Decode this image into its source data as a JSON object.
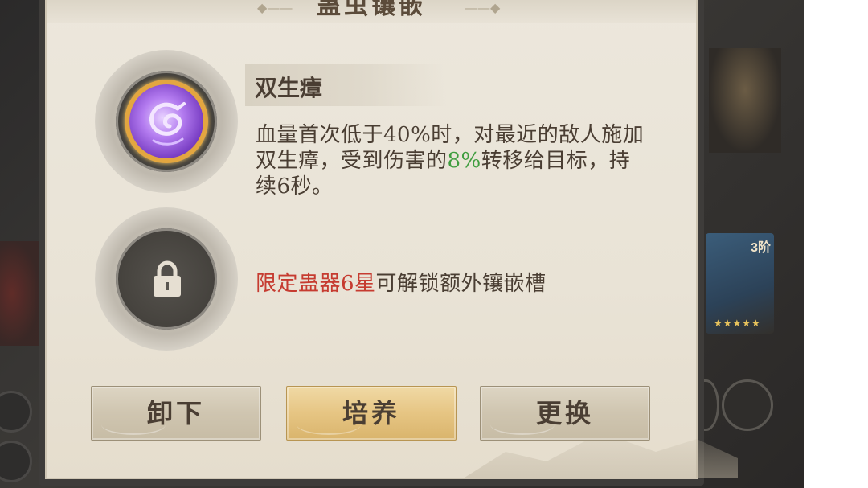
{
  "dialog": {
    "title": "蛊虫镶嵌"
  },
  "slot1": {
    "skill_name": "双生瘴",
    "desc_part1": "血量首次低于40%时，对最近的敌人施加双生瘴，受到伤害的",
    "desc_highlight": "8%",
    "desc_part2": "转移给目标，持续6秒。",
    "highlight_color": "#3f9d3f",
    "gem_icon": "purple-serpent-icon"
  },
  "slot2": {
    "lock_icon": "lock-icon",
    "unlock_condition": "限定蛊器6星",
    "unlock_text": "可解锁额外镶嵌槽",
    "condition_color": "#c63b30"
  },
  "buttons": {
    "unequip": "卸下",
    "cultivate": "培养",
    "replace": "更换"
  },
  "background": {
    "card_badge": "3阶",
    "card_stars": "★★★★★"
  }
}
